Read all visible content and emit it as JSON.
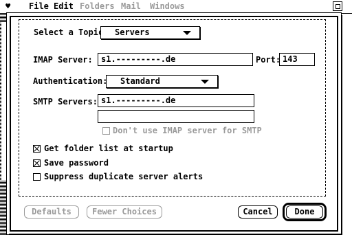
{
  "menubar": {
    "apple_glyph": "♥",
    "items": [
      {
        "label": "File",
        "enabled": true
      },
      {
        "label": "Edit",
        "enabled": true
      },
      {
        "label": "Folders",
        "enabled": false
      },
      {
        "label": "Mail",
        "enabled": false
      },
      {
        "label": "Windows",
        "enabled": false
      }
    ]
  },
  "dialog": {
    "topic": {
      "label": "Select a Topic:",
      "value": "Servers"
    },
    "imap": {
      "label": "IMAP Server:",
      "value": "s1.---------.de",
      "port_label": "Port:",
      "port_value": "143"
    },
    "auth": {
      "label": "Authentication:",
      "value": "Standard"
    },
    "smtp": {
      "label": "SMTP Servers:",
      "value1": "s1.---------.de",
      "value2": "",
      "dont_use_label": "Don't use IMAP server for SMTP",
      "dont_use_checked": false
    },
    "options": [
      {
        "label": "Get folder list at startup",
        "checked": true
      },
      {
        "label": "Save password",
        "checked": true
      },
      {
        "label": "Suppress duplicate server alerts",
        "checked": false
      }
    ],
    "buttons": {
      "defaults": "Defaults",
      "fewer": "Fewer Choices",
      "cancel": "Cancel",
      "done": "Done"
    }
  }
}
